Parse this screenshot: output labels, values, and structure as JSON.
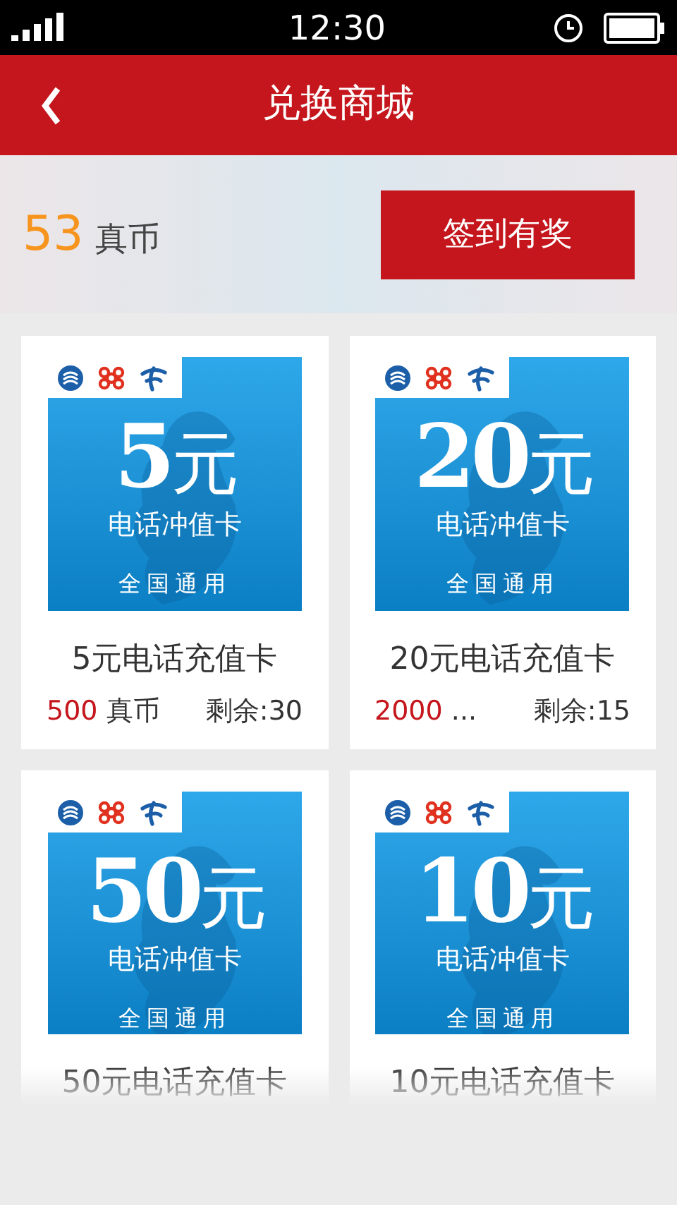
{
  "status_bar": {
    "time": "12:30"
  },
  "header": {
    "title": "兑换商城"
  },
  "balance": {
    "amount": "53",
    "unit": "真币"
  },
  "checkin_button": {
    "label": "签到有奖"
  },
  "products": [
    {
      "image": {
        "amount": "5",
        "unit": "元",
        "line1": "电话冲值卡",
        "line2": "全国通用"
      },
      "title": "5元电话充值卡",
      "price": "500",
      "price_unit": "真币",
      "stock": "剩余:30"
    },
    {
      "image": {
        "amount": "20",
        "unit": "元",
        "line1": "电话冲值卡",
        "line2": "全国通用"
      },
      "title": "20元电话充值卡",
      "price": "2000",
      "price_unit": "...",
      "stock": "剩余:15"
    },
    {
      "image": {
        "amount": "50",
        "unit": "元",
        "line1": "电话冲值卡",
        "line2": "全国通用"
      },
      "title": "50元电话充值卡"
    },
    {
      "image": {
        "amount": "10",
        "unit": "元",
        "line1": "电话冲值卡",
        "line2": "全国通用"
      },
      "title": "10元电话充值卡"
    }
  ]
}
